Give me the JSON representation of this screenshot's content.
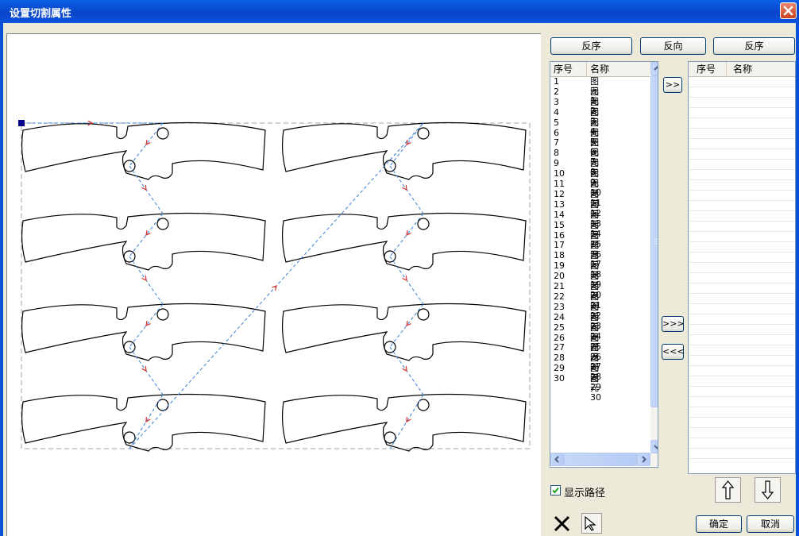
{
  "window": {
    "title": "设置切割属性"
  },
  "toolbar": {
    "btn1": "反序",
    "btn2": "反向",
    "btn3": "反序"
  },
  "left_list": {
    "col_num": "序号",
    "col_name": "名称",
    "rows": [
      {
        "num": "1",
        "name": "图元1"
      },
      {
        "num": "2",
        "name": "图元2"
      },
      {
        "num": "3",
        "name": "图元3"
      },
      {
        "num": "4",
        "name": "图元4"
      },
      {
        "num": "5",
        "name": "图元5"
      },
      {
        "num": "6",
        "name": "图元6"
      },
      {
        "num": "7",
        "name": "图元7"
      },
      {
        "num": "8",
        "name": "图元8"
      },
      {
        "num": "9",
        "name": "图元9"
      },
      {
        "num": "10",
        "name": "图元10"
      },
      {
        "num": "11",
        "name": "图元11"
      },
      {
        "num": "12",
        "name": "图元12"
      },
      {
        "num": "13",
        "name": "图元13"
      },
      {
        "num": "14",
        "name": "图元14"
      },
      {
        "num": "15",
        "name": "图元15"
      },
      {
        "num": "16",
        "name": "图元16"
      },
      {
        "num": "17",
        "name": "图元17"
      },
      {
        "num": "18",
        "name": "图元18"
      },
      {
        "num": "19",
        "name": "图元19"
      },
      {
        "num": "20",
        "name": "图元20"
      },
      {
        "num": "21",
        "name": "图元21"
      },
      {
        "num": "22",
        "name": "图元22"
      },
      {
        "num": "23",
        "name": "图元23"
      },
      {
        "num": "24",
        "name": "图元24"
      },
      {
        "num": "25",
        "name": "图元25"
      },
      {
        "num": "26",
        "name": "图元26"
      },
      {
        "num": "27",
        "name": "图元27"
      },
      {
        "num": "28",
        "name": "图元28"
      },
      {
        "num": "29",
        "name": "图元29"
      },
      {
        "num": "30",
        "name": "图元30"
      }
    ]
  },
  "right_list": {
    "col_num": "序号",
    "col_name": "名称"
  },
  "transfer": {
    "add_one": ">>",
    "add_all": ">>>",
    "remove_all": "<<<"
  },
  "show_path": {
    "label": "显示路径",
    "checked": true
  },
  "actions": {
    "ok": "确定",
    "cancel": "取消"
  },
  "colors": {
    "title_bar": "#0A5FE8",
    "path": "#3A7FD5",
    "arrow": "#D9302C",
    "shape": "#000000"
  },
  "icons": {
    "close": "close-icon",
    "up": "arrow-up-icon",
    "down": "arrow-down-icon",
    "clear": "x-icon",
    "select": "select-icon",
    "checkbox": "checkbox-icon"
  }
}
